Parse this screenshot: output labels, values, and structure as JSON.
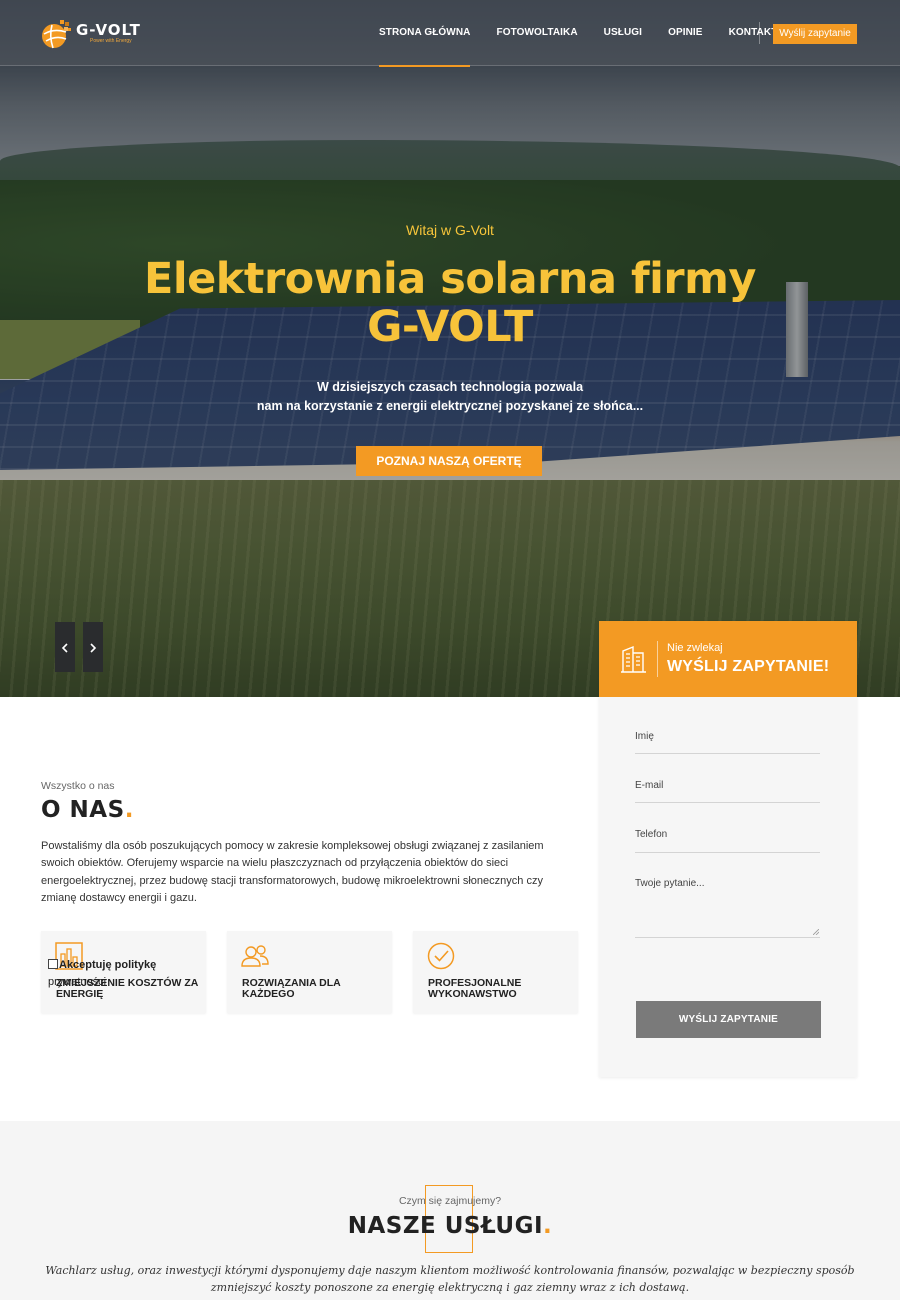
{
  "nav": {
    "logo_name": "G-VOLT",
    "logo_tagline": "Power with Energy",
    "items": [
      {
        "label": "STRONA GŁÓWNA",
        "active": true
      },
      {
        "label": "FOTOWOLTAIKA",
        "active": false
      },
      {
        "label": "USŁUGI",
        "active": false
      },
      {
        "label": "OPINIE",
        "active": false
      },
      {
        "label": "KONTAKT",
        "active": false
      }
    ],
    "cta_label": "Wyślij zapytanie"
  },
  "hero": {
    "kicker": "Witaj w G-Volt",
    "title_line1": "Elektrownia solarna firmy",
    "title_line2": "G-VOLT",
    "desc_line1": "W dzisiejszych czasach technologia pozwala",
    "desc_line2": "nam na korzystanie z energii elektrycznej pozyskanej ze słońca...",
    "button_label": "POZNAJ NASZĄ OFERTĘ",
    "prev_icon": "chevron-left-icon",
    "next_icon": "chevron-right-icon"
  },
  "form": {
    "kicker": "Nie zwlekaj",
    "title": "WYŚLIJ ZAPYTANIE!",
    "fields": {
      "name": "Imię",
      "email": "E-mail",
      "phone": "Telefon",
      "question": "Twoje pytanie..."
    },
    "consent_label": "Akceptuję politykę",
    "consent_link": "prywatności",
    "submit_label": "WYŚLIJ ZAPYTANIE"
  },
  "about": {
    "kicker": "Wszystko o nas",
    "title": "O NAS",
    "title_dot": ".",
    "text": "Powstaliśmy dla osób poszukujących pomocy w zakresie kompleksowej obsługi związanej z zasilaniem swoich obiektów. Oferujemy wsparcie na wielu płaszczyznach od przyłączenia obiektów do sieci energoelektrycznej, przez budowę stacji transformatorowych, budowę mikroelektrowni słonecznych czy zmianę dostawcy energii i gazu.",
    "features": [
      {
        "icon": "bar-chart-icon",
        "label": "ZMIEJSZENIE KOSZTÓW ZA ENERGIĘ"
      },
      {
        "icon": "users-icon",
        "label": "ROZWIĄZANIA DLA KAŻDEGO"
      },
      {
        "icon": "check-circle-icon",
        "label": "PROFESJONALNE WYKONAWSTWO"
      }
    ]
  },
  "services": {
    "kicker": "Czym się zajmujemy?",
    "title": "NASZE USŁUGI",
    "title_dot": ".",
    "desc": "Wachlarz usług, oraz inwestycji którymi dysponujemy daje naszym klientom możliwość kontrolowania finansów, pozwalając w bezpieczny sposób zmniejszyć koszty ponoszone za energię elektryczną i gaz ziemny wraz z ich dostawą."
  },
  "colors": {
    "accent": "#f39a23",
    "hero_title": "#f7c33a",
    "submit_bg": "#7a7a7a"
  }
}
